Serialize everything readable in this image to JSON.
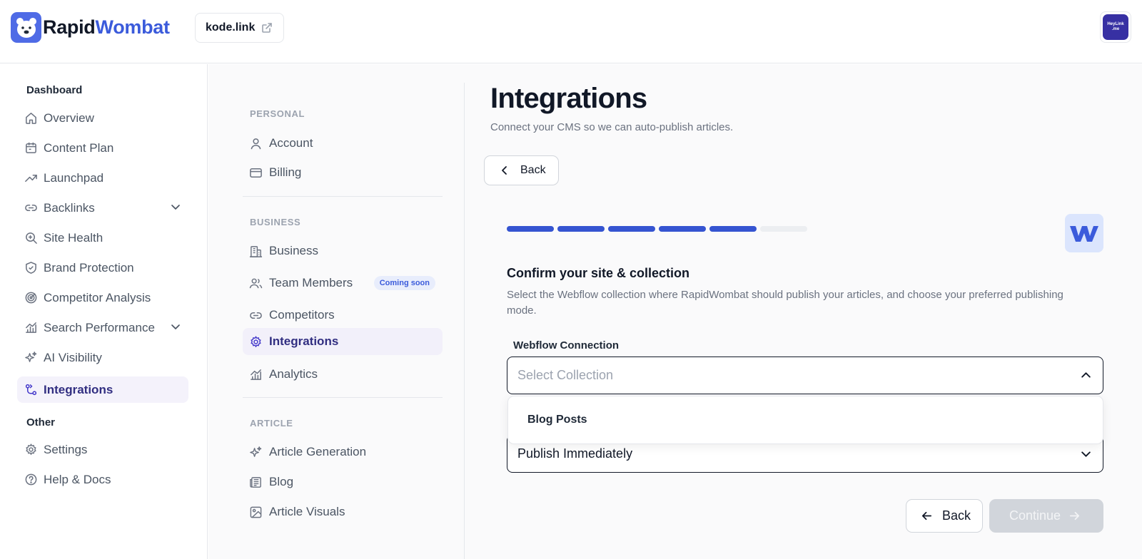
{
  "brand": {
    "name_part1": "Rapid",
    "name_part2": "Wombat",
    "color": "#3b5bdb"
  },
  "header": {
    "site": "kode.link",
    "avatar_line1": "HeyLink",
    "avatar_line2": ".me"
  },
  "sidebar": {
    "dashboard_label": "Dashboard",
    "other_label": "Other",
    "items": [
      {
        "label": "Overview",
        "icon": "home-icon"
      },
      {
        "label": "Content Plan",
        "icon": "calendar-icon"
      },
      {
        "label": "Launchpad",
        "icon": "trend-icon"
      },
      {
        "label": "Backlinks",
        "icon": "link-icon"
      },
      {
        "label": "Site Health",
        "icon": "search-icon"
      },
      {
        "label": "Brand Protection",
        "icon": "shield-icon"
      },
      {
        "label": "Competitor Analysis",
        "icon": "radar-icon"
      },
      {
        "label": "Search Performance",
        "icon": "chart-icon"
      },
      {
        "label": "AI Visibility",
        "icon": "sparkle-icon"
      },
      {
        "label": "Integrations",
        "icon": "integrations-icon"
      }
    ],
    "other_items": [
      {
        "label": "Settings",
        "icon": "gear-icon"
      },
      {
        "label": "Help & Docs",
        "icon": "help-icon"
      }
    ]
  },
  "settings_nav": {
    "groups": {
      "personal": "PERSONAL",
      "business": "BUSINESS",
      "article": "ARTICLE"
    },
    "personal": [
      "Account",
      "Billing"
    ],
    "business": [
      "Business",
      "Team Members",
      "Competitors",
      "Integrations",
      "Analytics"
    ],
    "article": [
      "Article Generation",
      "Blog",
      "Article Visuals"
    ],
    "coming_soon": "Coming soon"
  },
  "content": {
    "title": "Integrations",
    "subtitle": "Connect your CMS so we can auto-publish articles.",
    "back_label": "Back",
    "progress": {
      "total": 6,
      "completed": 5,
      "color": "#3554d1"
    },
    "step_title": "Confirm your site & collection",
    "step_desc": "Select the Webflow collection where RapidWombat should publish your articles, and choose your preferred publishing mode.",
    "field_label": "Webflow Connection",
    "collection_placeholder": "Select Collection",
    "dropdown_option": "Blog Posts",
    "publish_mode": "Publish Immediately",
    "footer_back": "Back",
    "footer_continue": "Continue"
  }
}
